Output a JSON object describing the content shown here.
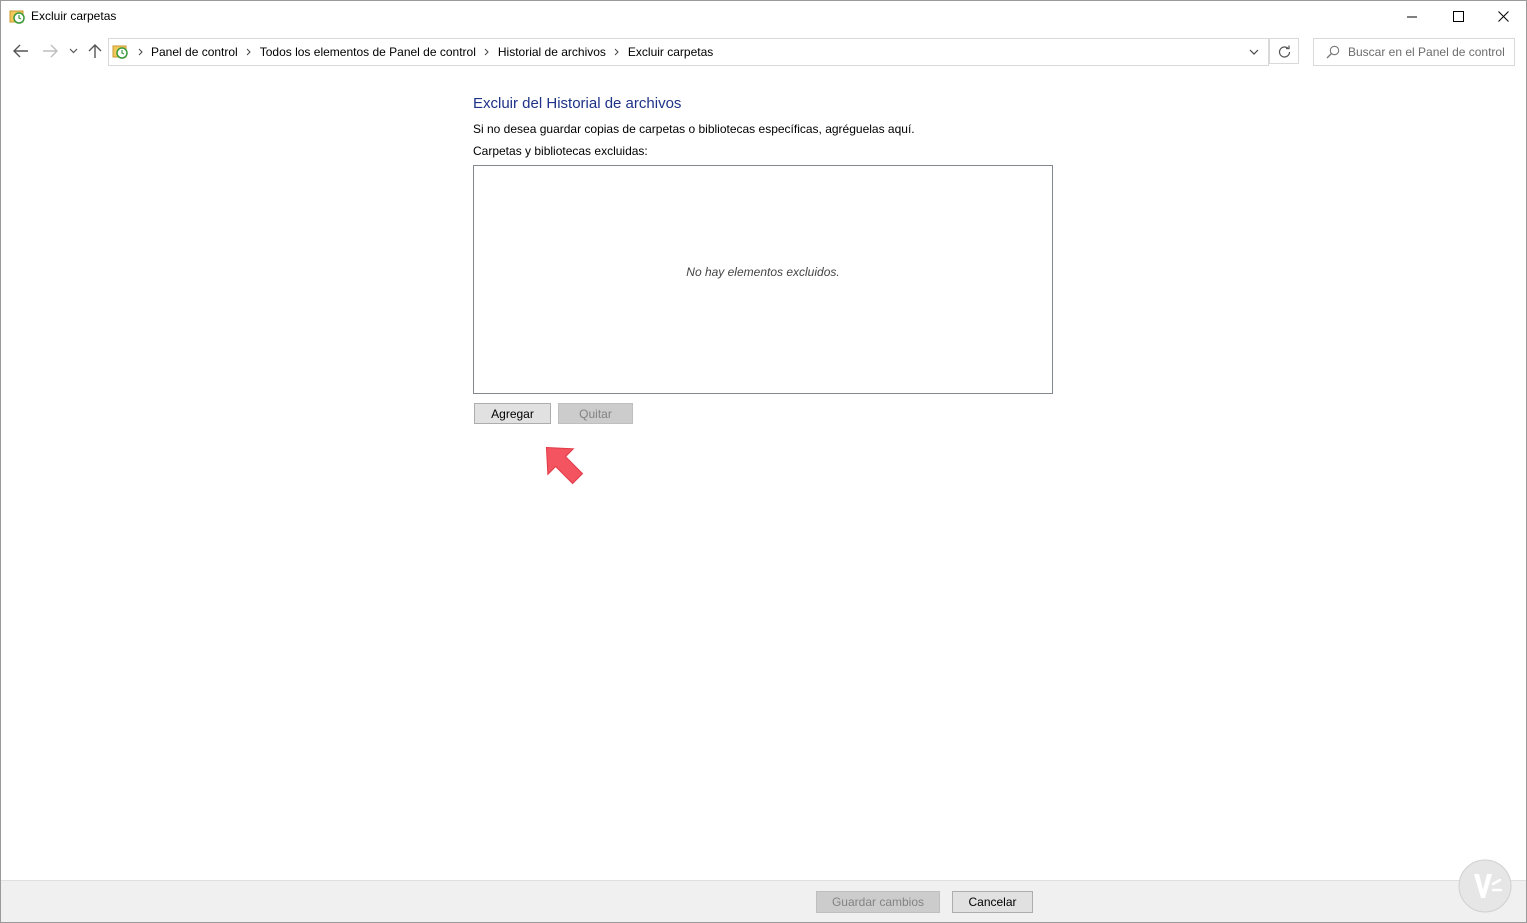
{
  "window": {
    "title": "Excluir carpetas"
  },
  "navigation": {
    "breadcrumbs": [
      "Panel de control",
      "Todos los elementos de Panel de control",
      "Historial de archivos",
      "Excluir carpetas"
    ],
    "search_placeholder": "Buscar en el Panel de control"
  },
  "main": {
    "heading": "Excluir del Historial de archivos",
    "description": "Si no desea guardar copias de carpetas o bibliotecas específicas, agréguelas aquí.",
    "list_label": "Carpetas y bibliotecas excluidas:",
    "empty_message": "No hay elementos excluidos.",
    "add_button": "Agregar",
    "remove_button": "Quitar"
  },
  "footer": {
    "save_button": "Guardar cambios",
    "cancel_button": "Cancelar"
  },
  "colors": {
    "heading": "#1e3287",
    "highlight_arrow": "#f4545f"
  }
}
